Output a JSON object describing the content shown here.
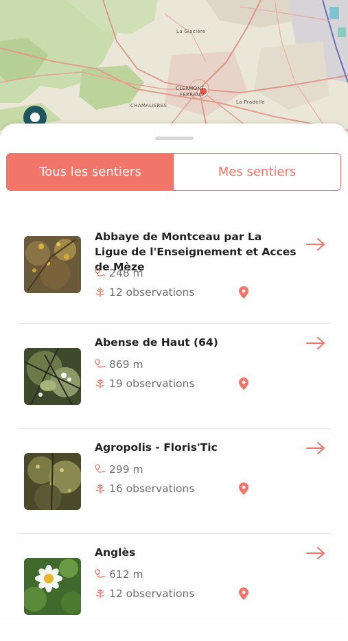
{
  "map": {
    "labels": [
      "CLERMONT-",
      "FERRAND",
      "CHAMALIERES",
      "La Glacière",
      "La Pradelle"
    ]
  },
  "tabs": {
    "all_label": "Tous les sentiers",
    "mine_label": "Mes sentiers"
  },
  "trails": [
    {
      "title": "Abbaye de Montceau par La Ligue de l'Enseignement et Acces de Mèze",
      "distance": "248 m",
      "observations": "12 observations"
    },
    {
      "title": "Abense de Haut (64)",
      "distance": "869 m",
      "observations": "19 observations"
    },
    {
      "title": "Agropolis - Floris'Tic",
      "distance": "299 m",
      "observations": "16 observations"
    },
    {
      "title": "Anglès",
      "distance": "612 m",
      "observations": "12 observations"
    }
  ],
  "colors": {
    "accent": "#f2756a",
    "map_pin": "#e8574a",
    "location_marker": "#1f5560"
  },
  "icons": {
    "distance": "route-pin-icon",
    "observations": "flower-icon",
    "location": "location-pin-icon",
    "go": "arrow-right-icon"
  }
}
